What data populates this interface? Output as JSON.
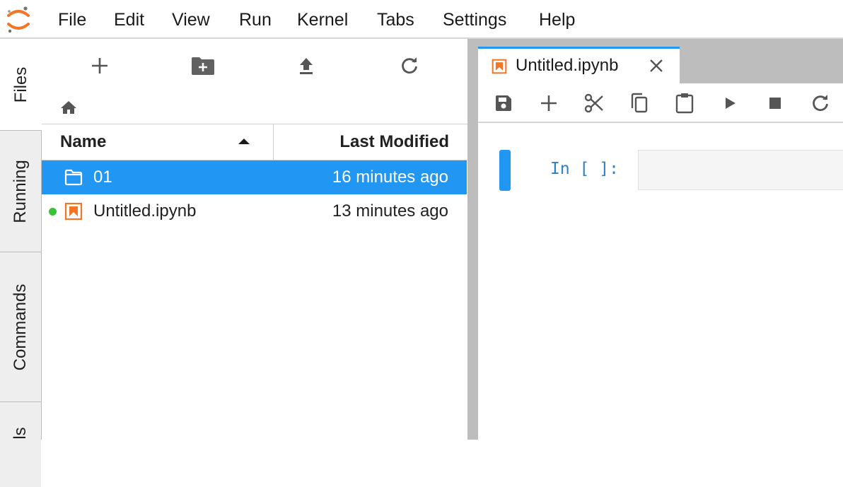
{
  "menu": {
    "items": [
      "File",
      "Edit",
      "View",
      "Run",
      "Kernel",
      "Tabs",
      "Settings",
      "Help"
    ]
  },
  "sidebar": {
    "tabs": [
      "Files",
      "Running",
      "Commands",
      "ls"
    ]
  },
  "file_browser": {
    "columns": {
      "name": "Name",
      "last_modified": "Last Modified"
    },
    "rows": [
      {
        "name": "01",
        "modified": "16 minutes ago",
        "type": "folder",
        "selected": true,
        "running": false
      },
      {
        "name": "Untitled.ipynb",
        "modified": "13 minutes ago",
        "type": "notebook",
        "selected": false,
        "running": true
      }
    ]
  },
  "notebook": {
    "tab_title": "Untitled.ipynb",
    "cell_prompt": "In [ ]:"
  },
  "colors": {
    "accent": "#2196f3",
    "notebook_icon": "#f37626",
    "running_dot": "#3ac13a",
    "prompt": "#307fc1"
  },
  "icons": {
    "logo": "jupyter-logo",
    "toolbar": [
      "new-launcher-icon",
      "new-folder-icon",
      "upload-icon",
      "refresh-icon"
    ],
    "notebook_toolbar": [
      "save-icon",
      "insert-cell-icon",
      "cut-icon",
      "copy-icon",
      "paste-icon",
      "run-icon",
      "stop-icon",
      "restart-icon"
    ]
  }
}
